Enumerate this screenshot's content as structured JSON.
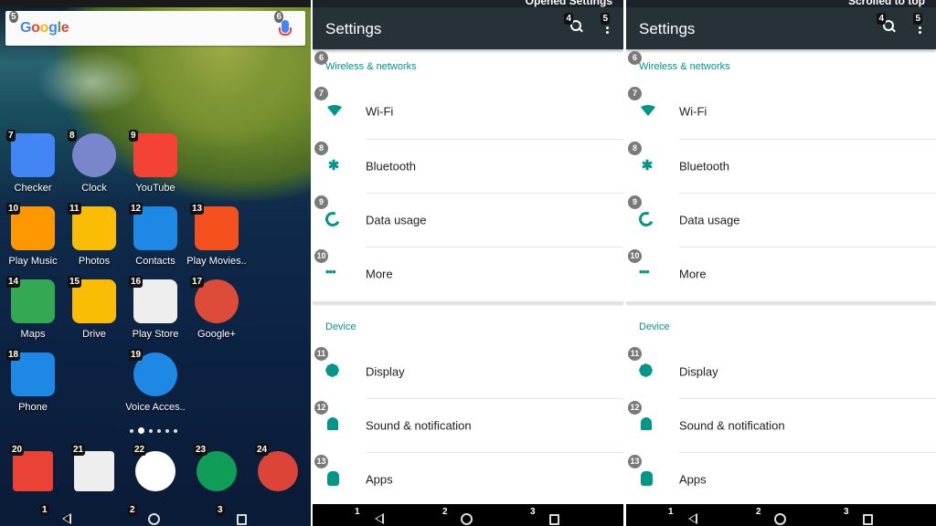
{
  "home": {
    "search": {
      "logo_letters": [
        "G",
        "o",
        "o",
        "g",
        "l",
        "e"
      ],
      "badge_logo": "5",
      "badge_mic": "6"
    },
    "apps": [
      {
        "badge": "7",
        "label": "Checker",
        "icon": "checker-icon",
        "color": "#4285f4"
      },
      {
        "badge": "8",
        "label": "Clock",
        "icon": "clock-icon",
        "color": "#7986cb"
      },
      {
        "badge": "9",
        "label": "YouTube",
        "icon": "youtube-icon",
        "color": "#f44336"
      },
      {
        "badge": "10",
        "label": "Play Music",
        "icon": "play-music-icon",
        "color": "#ff9800"
      },
      {
        "badge": "11",
        "label": "Photos",
        "icon": "photos-icon",
        "color": "#fbbc05"
      },
      {
        "badge": "12",
        "label": "Contacts",
        "icon": "contacts-icon",
        "color": "#1e88e5"
      },
      {
        "badge": "13",
        "label": "Play Movies..",
        "icon": "play-movies-icon",
        "color": "#f4511e"
      },
      {
        "badge": "14",
        "label": "Maps",
        "icon": "maps-icon",
        "color": "#34a853"
      },
      {
        "badge": "15",
        "label": "Drive",
        "icon": "drive-icon",
        "color": "#fbbc05"
      },
      {
        "badge": "16",
        "label": "Play Store",
        "icon": "play-store-icon",
        "color": "#eeeeee"
      },
      {
        "badge": "17",
        "label": "Google+",
        "icon": "google-plus-icon",
        "color": "#dd4b39"
      },
      {
        "badge": "18",
        "label": "Phone",
        "icon": "phone-icon",
        "color": "#1e88e5"
      },
      {
        "badge": "19",
        "label": "Voice Acces..",
        "icon": "voice-access-icon",
        "color": "#1e88e5"
      }
    ],
    "dock": [
      {
        "badge": "20",
        "icon": "gmail-icon",
        "color": "#ea4335"
      },
      {
        "badge": "21",
        "icon": "camera-icon",
        "color": "#eeeeee"
      },
      {
        "badge": "22",
        "icon": "app-drawer-icon",
        "color": "#ffffff"
      },
      {
        "badge": "23",
        "icon": "hangouts-icon",
        "color": "#0f9d58"
      },
      {
        "badge": "24",
        "icon": "chrome-icon",
        "color": "#db4437"
      }
    ],
    "page_indicator": {
      "count": 6,
      "active": 1
    },
    "nav": {
      "back_badge": "1",
      "home_badge": "2",
      "recents_badge": "3"
    }
  },
  "settings_panels": [
    {
      "status_text": "Opened Settings",
      "title": "Settings",
      "search_badge": "4",
      "menu_badge": "5",
      "sections": [
        {
          "badge": "6",
          "label": "Wireless & networks"
        },
        {
          "label": "Device"
        }
      ],
      "items": [
        {
          "badge": "7",
          "label": "Wi-Fi",
          "icon": "wifi-icon"
        },
        {
          "badge": "8",
          "label": "Bluetooth",
          "icon": "bluetooth-icon"
        },
        {
          "badge": "9",
          "label": "Data usage",
          "icon": "data-usage-icon"
        },
        {
          "badge": "10",
          "label": "More",
          "icon": "more-horiz-icon"
        },
        {
          "badge": "11",
          "label": "Display",
          "icon": "display-icon"
        },
        {
          "badge": "12",
          "label": "Sound & notification",
          "icon": "bell-icon"
        },
        {
          "badge": "13",
          "label": "Apps",
          "icon": "android-icon"
        }
      ],
      "nav": {
        "back_badge": "1",
        "home_badge": "2",
        "recents_badge": "3"
      }
    },
    {
      "status_text": "Scrolled to top",
      "title": "Settings",
      "search_badge": "4",
      "menu_badge": "5",
      "sections": [
        {
          "badge": "6",
          "label": "Wireless & networks"
        },
        {
          "label": "Device"
        }
      ],
      "items": [
        {
          "badge": "7",
          "label": "Wi-Fi",
          "icon": "wifi-icon"
        },
        {
          "badge": "8",
          "label": "Bluetooth",
          "icon": "bluetooth-icon"
        },
        {
          "badge": "9",
          "label": "Data usage",
          "icon": "data-usage-icon"
        },
        {
          "badge": "10",
          "label": "More",
          "icon": "more-horiz-icon"
        },
        {
          "badge": "11",
          "label": "Display",
          "icon": "display-icon"
        },
        {
          "badge": "12",
          "label": "Sound & notification",
          "icon": "bell-icon"
        },
        {
          "badge": "13",
          "label": "Apps",
          "icon": "android-icon"
        }
      ],
      "nav": {
        "back_badge": "1",
        "home_badge": "2",
        "recents_badge": "3"
      }
    }
  ],
  "colors": {
    "accent": "#009688",
    "toolbar": "#263238",
    "status": "#1c2328"
  }
}
